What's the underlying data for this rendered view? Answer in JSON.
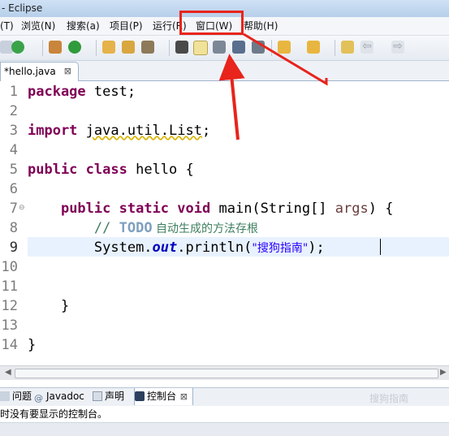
{
  "window": {
    "title": "- Eclipse"
  },
  "menubar": {
    "items": [
      {
        "label": "(T)"
      },
      {
        "label": "浏览(N)"
      },
      {
        "label": "搜索(a)"
      },
      {
        "label": "项目(P)"
      },
      {
        "label": "运行(R)"
      },
      {
        "label": "窗口(W)"
      },
      {
        "label": "帮助(H)"
      }
    ]
  },
  "editor_tab": {
    "label": "*hello.java",
    "close": "⊠"
  },
  "editor": {
    "line_numbers": [
      "1",
      "2",
      "3",
      "4",
      "5",
      "6",
      "7",
      "8",
      "9",
      "10",
      "11",
      "12",
      "13",
      "14"
    ],
    "code": {
      "l1_kw": "package",
      "l1_rest": " test;",
      "l3_kw": "import",
      "l3_sp": " ",
      "l3_squiggle": "java.util.List",
      "l3_semi": ";",
      "l5_kw1": "public",
      "l5_sp": " ",
      "l5_kw2": "class",
      "l5_rest": " hello {",
      "l7_indent": "    ",
      "l7_kw1": "public",
      "l7_kw2": "static",
      "l7_kw3": "void",
      "l7_mid": " main(String[] ",
      "l7_param": "args",
      "l7_end": ") {",
      "l8_indent": "        ",
      "l8_comment": "// ",
      "l8_todo": "TODO",
      "l8_cjk": " 自动生成的方法存根",
      "l9_indent": "        ",
      "l9_a": "System.",
      "l9_field": "out",
      "l9_b": ".println(",
      "l9_str": "\"搜狗指南\"",
      "l9_c": ");",
      "l12": "    }",
      "l14": "}"
    }
  },
  "bottom_tabs": [
    {
      "label": "问题"
    },
    {
      "label": "Javadoc"
    },
    {
      "label": "声明"
    },
    {
      "label": "控制台"
    }
  ],
  "console": {
    "message": "时没有要显示的控制台。"
  },
  "watermark": "搜狗指南",
  "colors": {
    "keyword": "#7f0055",
    "comment": "#3f7f5f",
    "string": "#2a00ff",
    "annotation_red": "#e8241c"
  }
}
